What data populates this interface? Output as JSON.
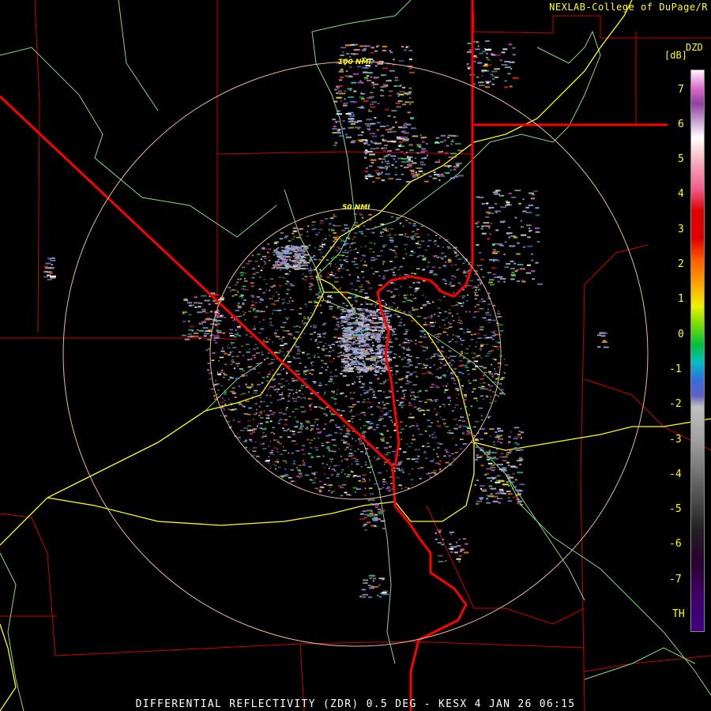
{
  "header": {
    "credit": "NEXLAB-College of DuPage/R",
    "product_code": "DZD",
    "units": "[dB]"
  },
  "footer": {
    "caption": "DIFFERENTIAL REFLECTIVITY (ZDR) 0.5 DEG - KESX 4 JAN 26 06:15"
  },
  "range_rings": [
    {
      "label": "50 NMI"
    },
    {
      "label": "100 NMI"
    }
  ],
  "legend": {
    "ticks": [
      "7",
      "6",
      "5",
      "4",
      "3",
      "2",
      "1",
      "0",
      "-1",
      "-2",
      "-3",
      "-4",
      "-5",
      "-6",
      "-7",
      "TH"
    ]
  },
  "colors": {
    "state_border": "#ff0000",
    "county_border": "#cc0000",
    "highway": "#ffff00",
    "river": "#7fdc7f",
    "range_ring": "#e8b89a",
    "text": "#ffff00"
  }
}
